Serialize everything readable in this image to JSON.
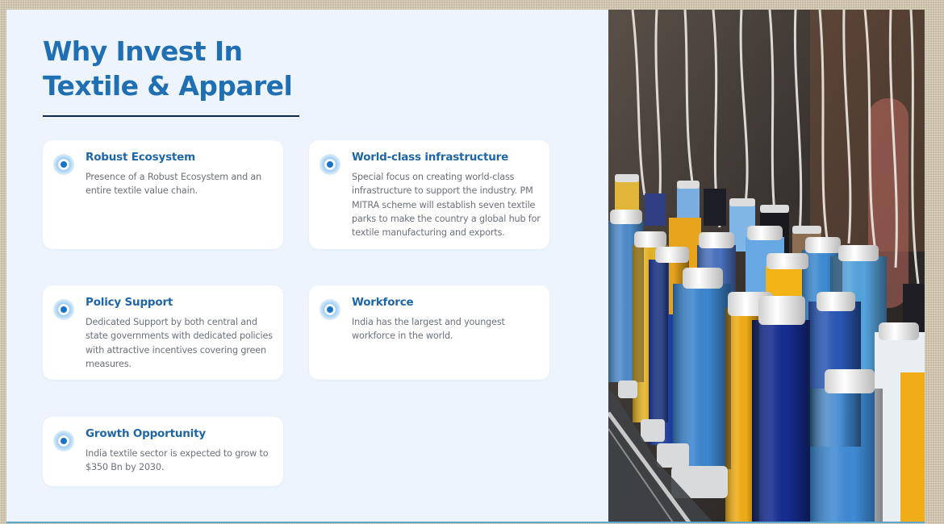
{
  "heading": {
    "line1": "Why Invest In",
    "line2": "Textile & Apparel"
  },
  "cards": [
    {
      "title": "Robust Ecosystem",
      "text": "Presence of a Robust Ecosystem and an entire textile value chain."
    },
    {
      "title": "World-class infrastructure",
      "text": "Special focus on creating world-class infrastructure to support the industry. PM MITRA scheme will establish seven textile parks to make the country a global hub for textile manufacturing and exports."
    },
    {
      "title": "Policy Support",
      "text": "Dedicated Support by both central and state governments with dedicated policies with attractive incentives covering green measures."
    },
    {
      "title": "Workforce",
      "text": "India has the largest and youngest workforce in the world."
    },
    {
      "title": "Growth Opportunity",
      "text": "India textile sector is expected to grow to $350 Bn by 2030."
    }
  ],
  "colors": {
    "accent": "#1f6fb2",
    "panel_background": "#edf4fd",
    "card_background": "#ffffff",
    "body_text": "#6b717a",
    "heading_underline": "#0e2a4a"
  },
  "icons": {
    "card_bullet": "blue-dot-icon"
  },
  "photo": {
    "subject": "thread-spools-photo"
  }
}
